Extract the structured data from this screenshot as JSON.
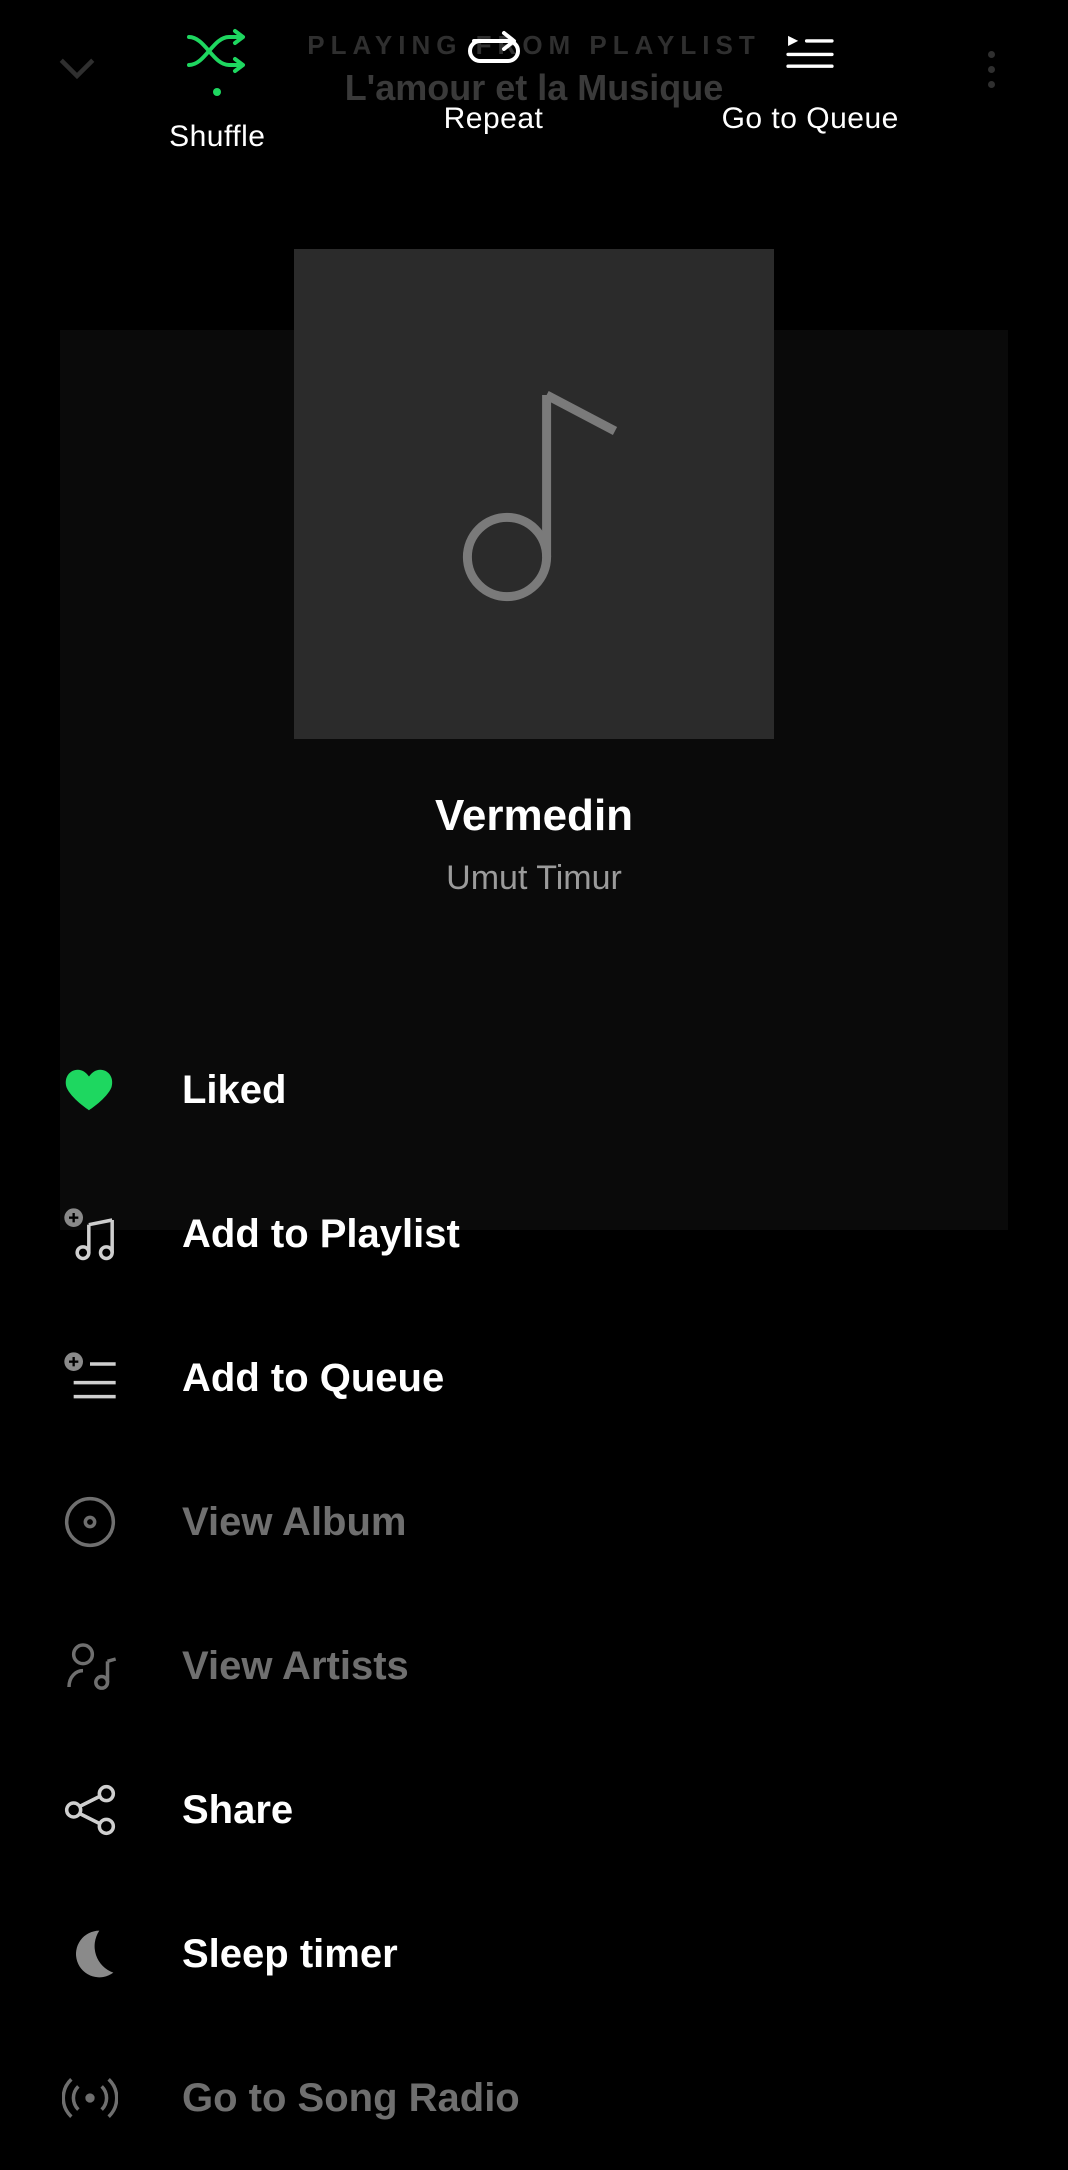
{
  "background": {
    "context_line": "PLAYING FROM PLAYLIST",
    "playlist_name": "L'amour et la Musique"
  },
  "top_actions": {
    "shuffle": "Shuffle",
    "repeat": "Repeat",
    "queue": "Go to Queue"
  },
  "track": {
    "title": "Vermedin",
    "artist": "Umut Timur"
  },
  "menu": {
    "liked": "Liked",
    "add_playlist": "Add to Playlist",
    "add_queue": "Add to Queue",
    "view_album": "View Album",
    "view_artists": "View Artists",
    "share": "Share",
    "sleep_timer": "Sleep timer",
    "song_radio": "Go to Song Radio"
  },
  "colors": {
    "accent": "#1ed760"
  }
}
